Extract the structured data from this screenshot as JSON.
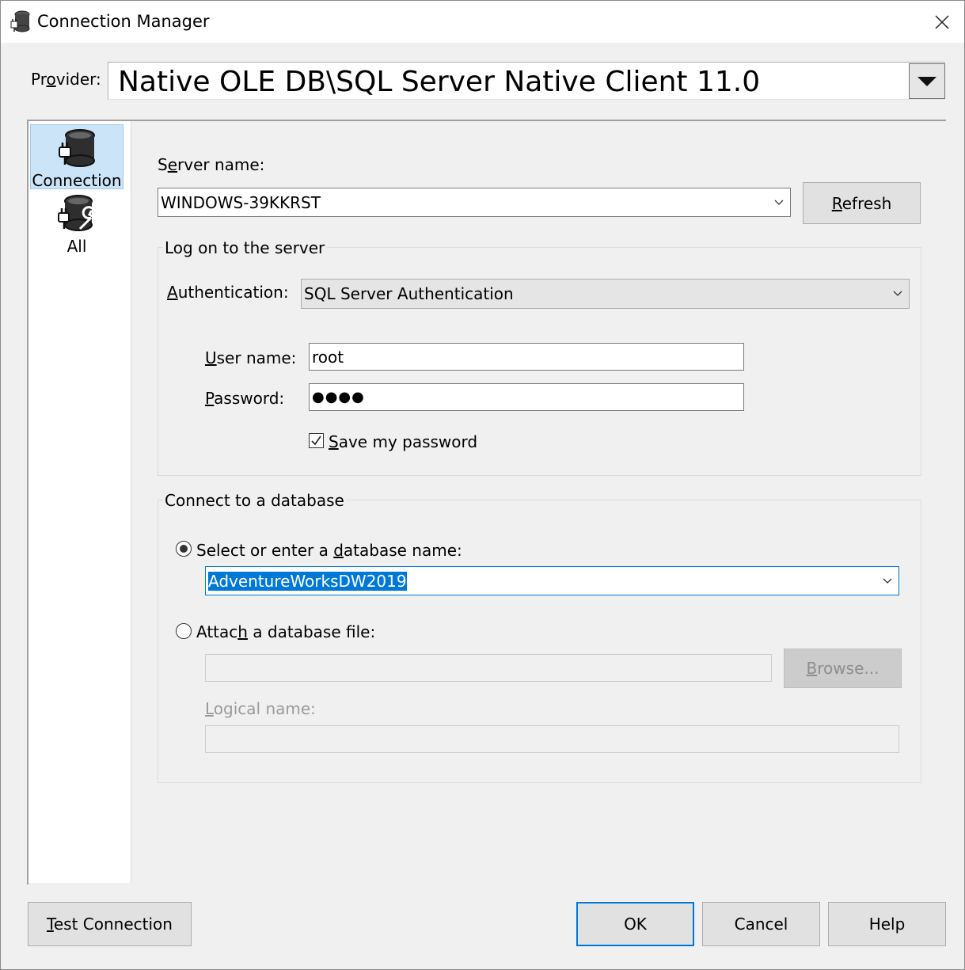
{
  "window": {
    "title": "Connection Manager",
    "title_icon": "database-plug-icon",
    "close_icon": "close-icon"
  },
  "provider": {
    "label_pre": "Pr",
    "label_u": "o",
    "label_post": "vider:",
    "value": "Native OLE DB\\SQL Server Native Client 11.0"
  },
  "nav": {
    "items": [
      {
        "label": "Connection",
        "icon": "database-plug-icon",
        "selected": true
      },
      {
        "label": "All",
        "icon": "database-wrench-icon",
        "selected": false
      }
    ]
  },
  "server": {
    "label_pre": "S",
    "label_u": "e",
    "label_post": "rver name:",
    "value": "WINDOWS-39KKRST",
    "refresh_u": "R",
    "refresh_post": "efresh"
  },
  "logon": {
    "group_title": "Log on to the server",
    "auth_u": "A",
    "auth_post": "uthentication:",
    "auth_value": "SQL Server Authentication",
    "user_u": "U",
    "user_post": "ser name:",
    "user_value": "root",
    "password_u": "P",
    "password_post": "assword:",
    "password_value": "●●●●",
    "save_u": "S",
    "save_post": "ave my password",
    "save_checked": true
  },
  "database": {
    "group_title": "Connect to a database",
    "select_pre": "Select or enter a ",
    "select_u": "d",
    "select_post": "atabase name:",
    "select_value": "AdventureWorksDW2019",
    "attach_pre": "Attac",
    "attach_u": "h",
    "attach_post": " a database file:",
    "browse_u": "B",
    "browse_post": "rowse...",
    "logical_u": "L",
    "logical_post": "ogical name:"
  },
  "footer": {
    "test_u": "T",
    "test_post": "est Connection",
    "ok": "OK",
    "cancel": "Cancel",
    "help": "Help"
  }
}
